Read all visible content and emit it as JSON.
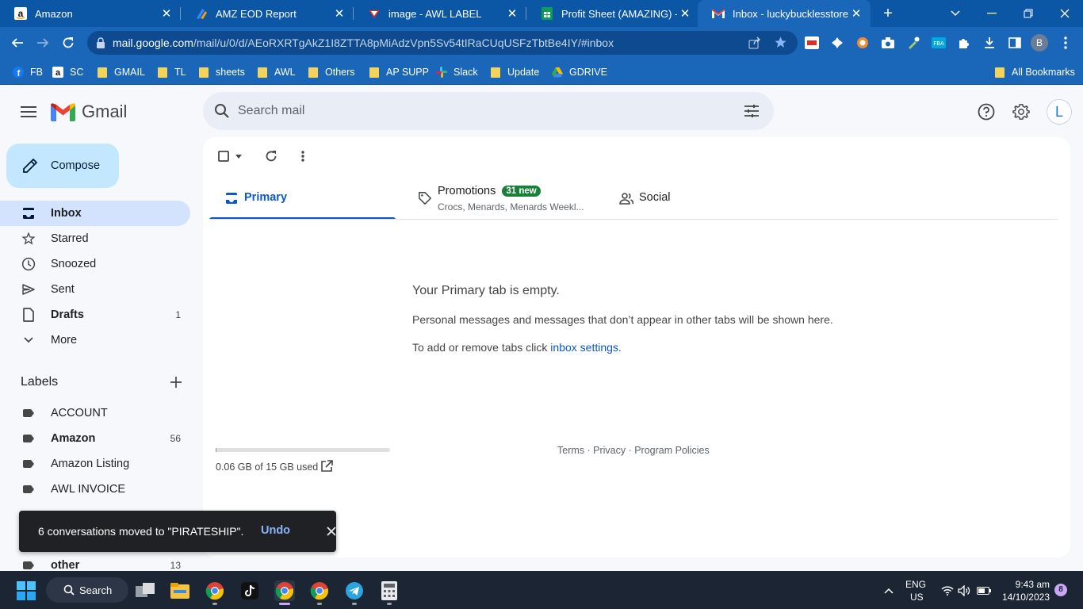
{
  "browser": {
    "tabs": [
      {
        "title": "Amazon"
      },
      {
        "title": "AMZ EOD Report"
      },
      {
        "title": "image - AWL LABEL"
      },
      {
        "title": "Profit Sheet (AMAZING) - Go"
      },
      {
        "title": "Inbox - luckybucklesstore@g"
      }
    ],
    "url_host": "mail.google.com",
    "url_rest": "/mail/u/0/d/AEoRXRTgAkZ1I8ZTTA8pMiAdzVpn5Sv54tIRaCUqUSFzTbtBe4IY/#inbox",
    "profile_letter": "B",
    "bookmarks": [
      "FB",
      "SC",
      "GMAIL",
      "TL",
      "sheets",
      "AWL",
      "Others",
      "AP SUPP",
      "Slack",
      "Update",
      "GDRIVE"
    ],
    "all_bookmarks": "All Bookmarks"
  },
  "gmail": {
    "brand": "Gmail",
    "search_placeholder": "Search mail",
    "avatar_letter": "L",
    "compose": "Compose",
    "nav": [
      {
        "label": "Inbox",
        "count": ""
      },
      {
        "label": "Starred",
        "count": ""
      },
      {
        "label": "Snoozed",
        "count": ""
      },
      {
        "label": "Sent",
        "count": ""
      },
      {
        "label": "Drafts",
        "count": "1"
      },
      {
        "label": "More",
        "count": ""
      }
    ],
    "labels_title": "Labels",
    "labels": [
      {
        "label": "ACCOUNT",
        "count": ""
      },
      {
        "label": "Amazon",
        "count": "56"
      },
      {
        "label": "Amazon Listing",
        "count": ""
      },
      {
        "label": "AWL INVOICE",
        "count": ""
      },
      {
        "label": "other",
        "count": "13"
      }
    ],
    "tabs": {
      "primary": "Primary",
      "promotions": "Promotions",
      "promotions_badge": "31 new",
      "promotions_sub": "Crocs, Menards, Menards Weekl...",
      "social": "Social"
    },
    "empty": {
      "title": "Your Primary tab is empty.",
      "text": "Personal messages and messages that don’t appear in other tabs will be shown here.",
      "text2_prefix": "To add or remove tabs click ",
      "text2_link": "inbox settings",
      "text2_suffix": "."
    },
    "storage": {
      "text": "0.06 GB of 15 GB used",
      "fraction": 0.004
    },
    "footer": "Terms · Privacy · Program Policies",
    "toast": {
      "message": "6 conversations moved to \"PIRATESHIP\".",
      "action": "Undo"
    }
  },
  "taskbar": {
    "search": "Search",
    "lang1": "ENG",
    "lang2": "US",
    "time": "9:43 am",
    "date": "14/10/2023",
    "notifications": "8"
  },
  "colors": {
    "accent": "#0b57d0",
    "compose_bg": "#c2e7ff",
    "active_nav": "#d3e3fd",
    "badge": "#188038",
    "chrome": "#1a66b8"
  }
}
